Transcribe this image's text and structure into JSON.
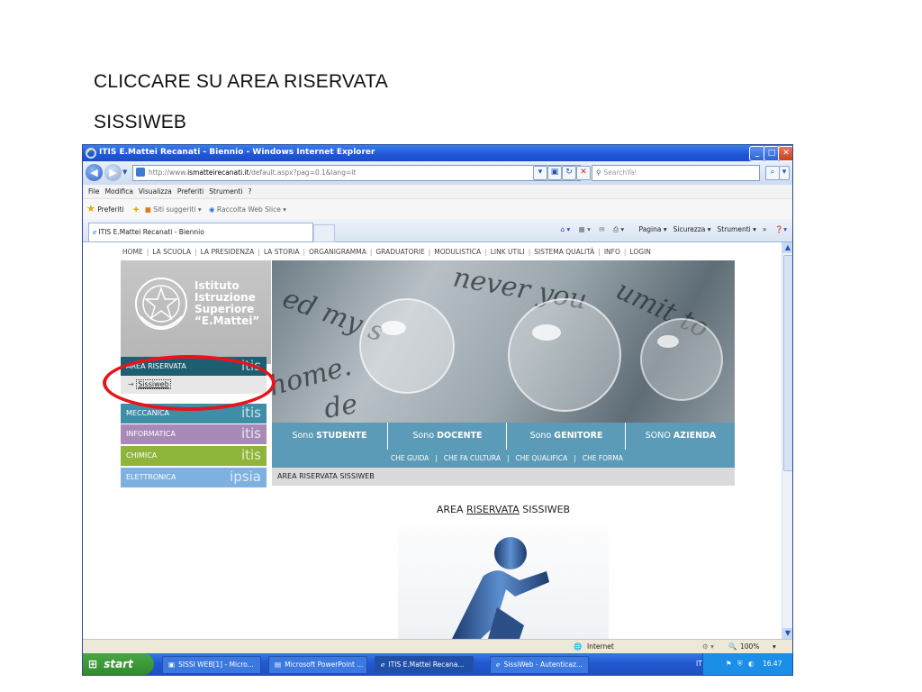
{
  "slide": {
    "title_line1": "CLICCARE SU AREA RISERVATA",
    "title_line2": "SISSIWEB"
  },
  "window": {
    "title": "ITIS E.Mattei Recanati - Biennio - Windows Internet Explorer",
    "address_prefix": "http://www.",
    "address_domain": "ismatteirecanati.it",
    "address_path": "/default.aspx?pag=0.1&lang=it",
    "search_placeholder": "SearchYa!"
  },
  "menubar": [
    "File",
    "Modifica",
    "Visualizza",
    "Preferiti",
    "Strumenti",
    "?"
  ],
  "favorites": {
    "label": "Preferiti",
    "suggested": "Siti suggeriti ▾",
    "webslice": "Raccolta Web Slice ▾"
  },
  "tab": {
    "label": "ITIS E.Mattei Recanati - Biennio"
  },
  "commandbar": [
    "Pagina ▾",
    "Sicurezza ▾",
    "Strumenti ▾",
    "»"
  ],
  "site": {
    "topnav": [
      "HOME",
      "LA SCUOLA",
      "LA PRESIDENZA",
      "LA STORIA",
      "ORGANIGRAMMA",
      "GRADUATORIE",
      "MODULISTICA",
      "LINK UTILI",
      "SISTEMA QUALITÀ",
      "INFO",
      "LOGIN"
    ],
    "logo_lines": [
      "Istituto",
      "Istruzione",
      "Superiore",
      "“E.Mattei”"
    ],
    "sidebar": [
      {
        "label": "AREA RISERVATA",
        "brand": "itis",
        "color": "#1d5e73"
      },
      {
        "label": "MECCANICA",
        "brand": "itis",
        "color": "#3f8ea8"
      },
      {
        "label": "INFORMATICA",
        "brand": "itis",
        "color": "#a88ab8"
      },
      {
        "label": "CHIMICA",
        "brand": "itis",
        "color": "#8fb43a"
      },
      {
        "label": "ELETTRONICA",
        "brand": "ipsia",
        "color": "#7fb1e0"
      }
    ],
    "submenu_item": "Sissiweb",
    "roles": [
      {
        "prefix": "Sono ",
        "bold": "STUDENTE"
      },
      {
        "prefix": "Sono ",
        "bold": "DOCENTE"
      },
      {
        "prefix": "Sono ",
        "bold": "GENITORE"
      },
      {
        "prefix": "SONO ",
        "bold": "AZIENDA"
      }
    ],
    "role_links": [
      "CHE GUIDA",
      "CHE FA CULTURA",
      "CHE QUALIFICA",
      "CHE FORMA"
    ],
    "breadcrumb": "AREA RISERVATA SISSIWEB",
    "heading_before": "AREA ",
    "heading_link": "RISERVATA",
    "heading_after": " SISSIWEB"
  },
  "statusbar": {
    "zone": "Internet",
    "zoom": "100%"
  },
  "taskbar": {
    "start": "start",
    "items": [
      "SISSI WEB[1] - Micro...",
      "Microsoft PowerPoint ...",
      "ITIS E.Mattei Recana...",
      "SissiWeb - Autenticaz..."
    ],
    "lang": "IT",
    "clock": "16.47"
  },
  "colors": {
    "annotation_ring": "#e8141b",
    "titlebar": "#1f55d8",
    "role_bar": "#5b9bb7"
  }
}
